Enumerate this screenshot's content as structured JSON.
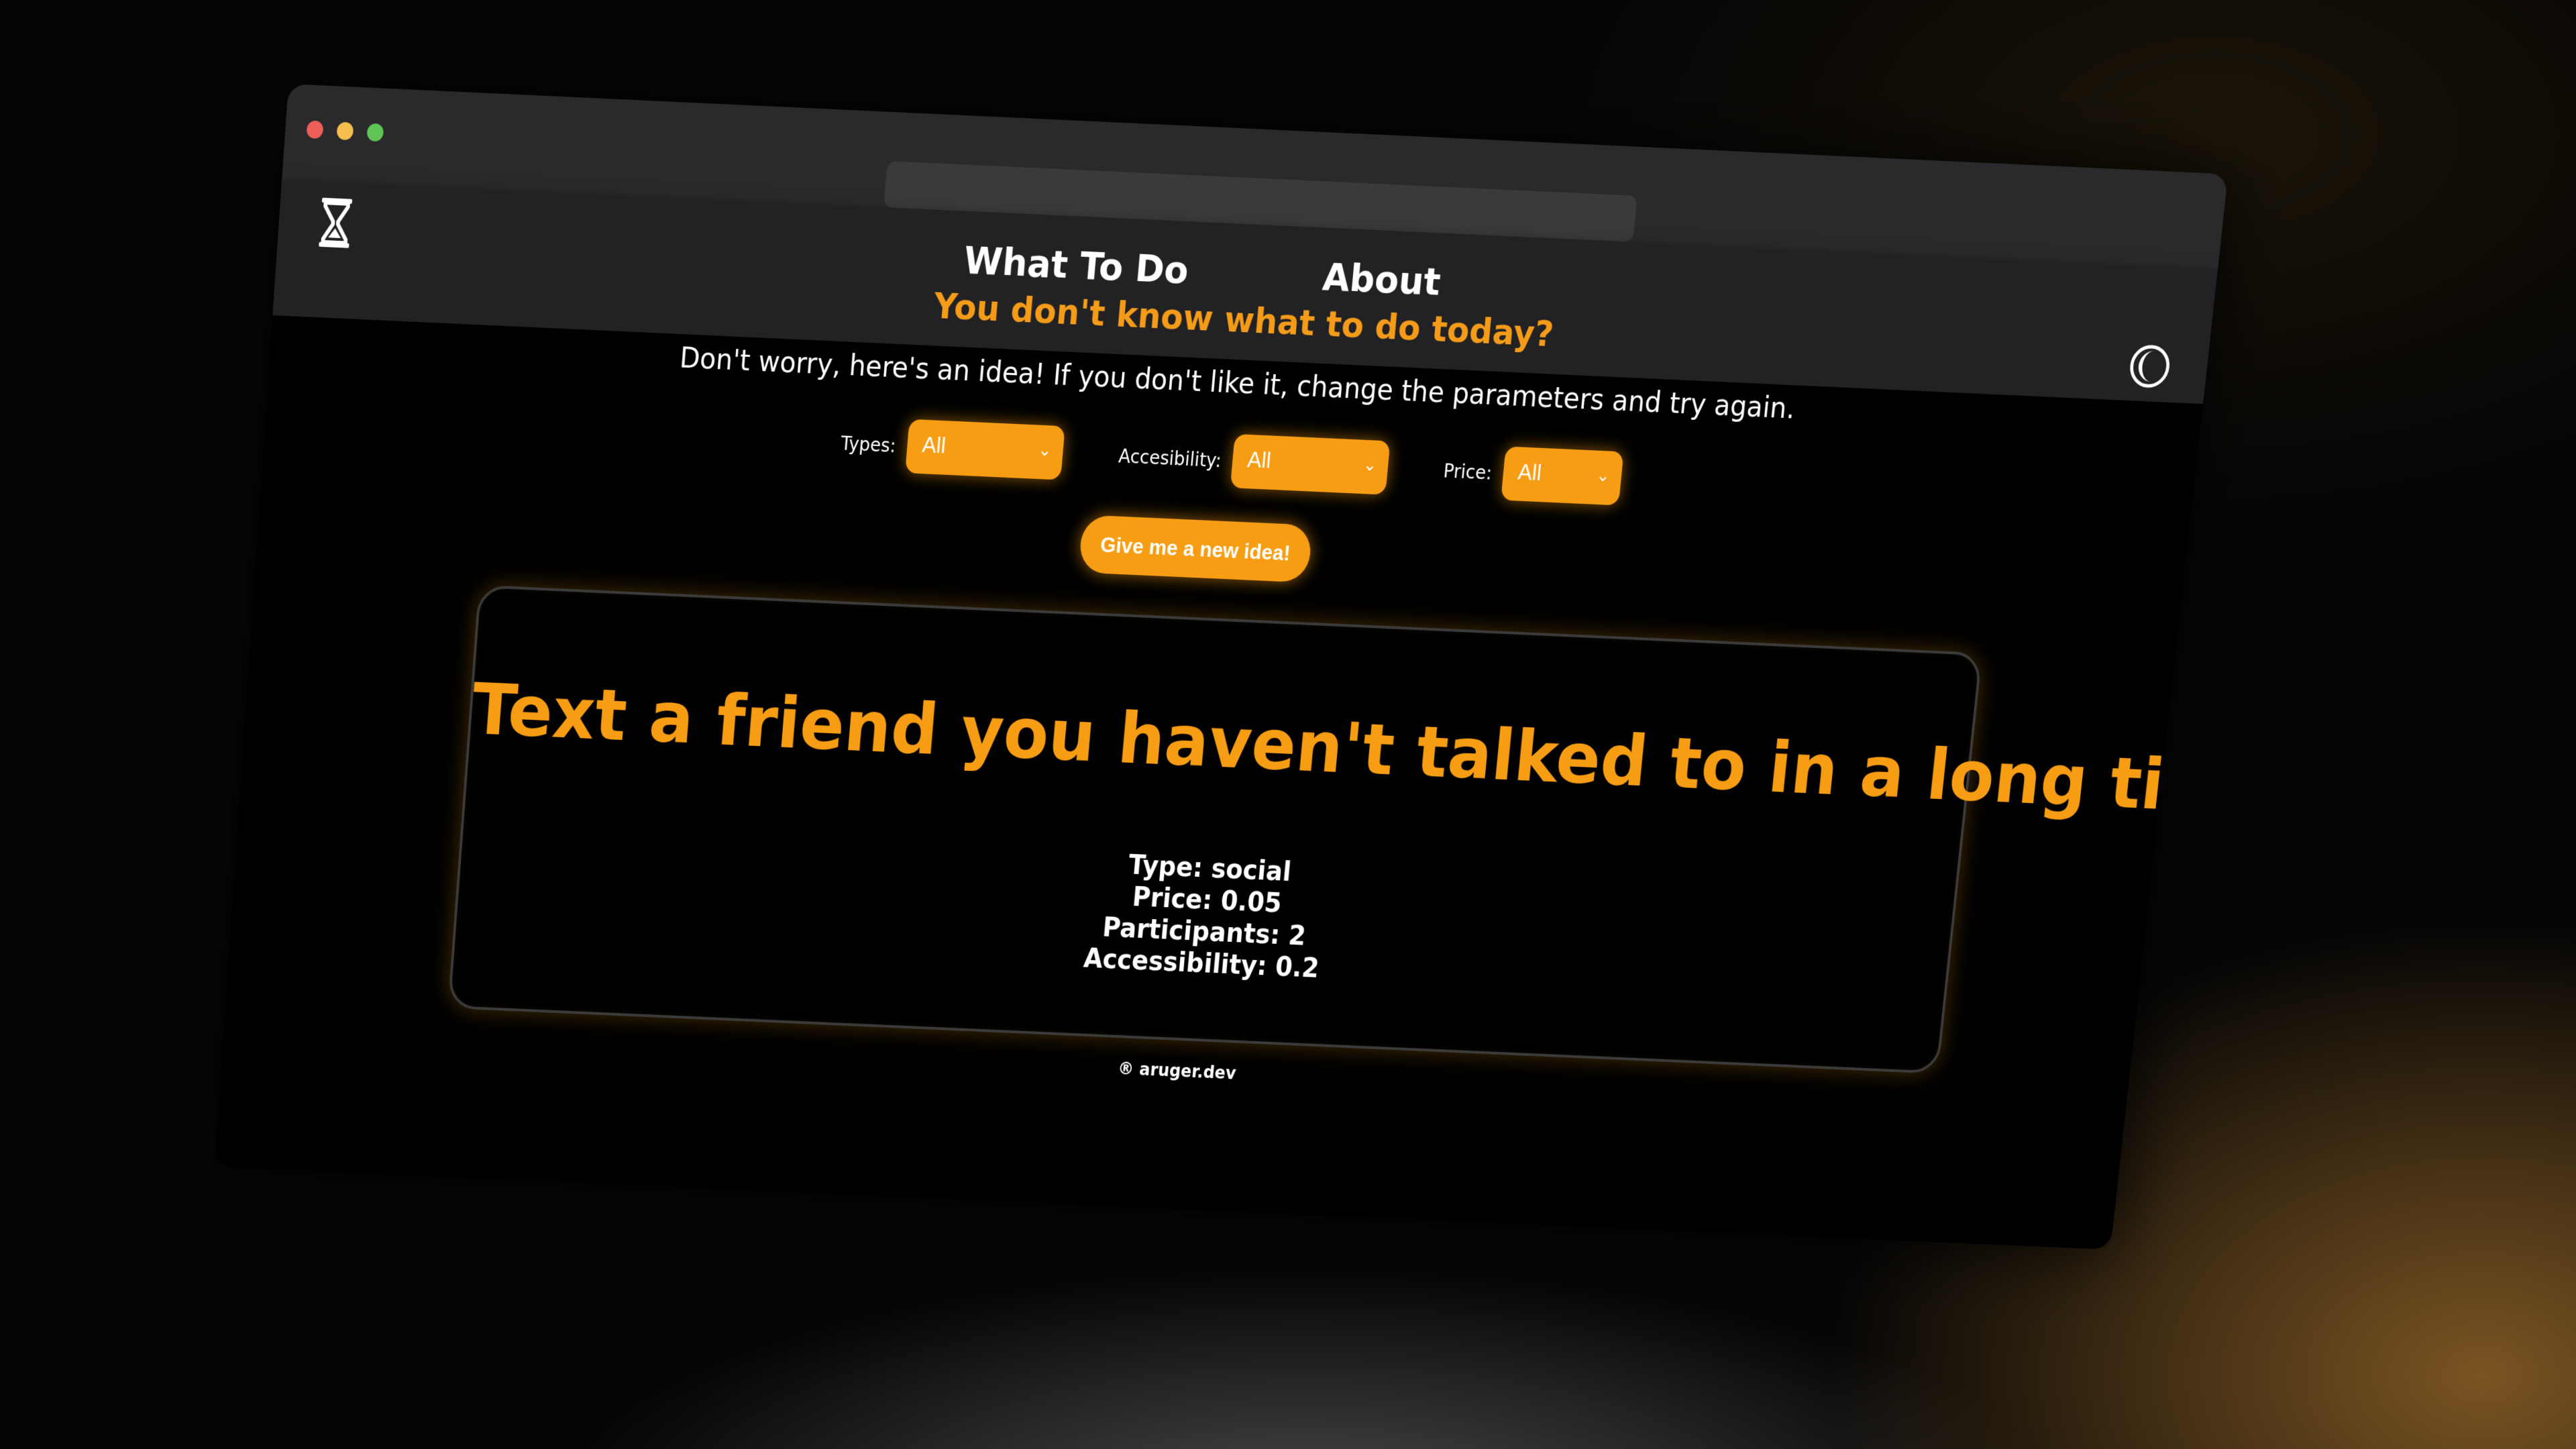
{
  "nav": {
    "what_to_do": "What To Do",
    "about": "About",
    "logo_icon": "hourglass-icon",
    "theme_icon": "moon-icon"
  },
  "hero": {
    "headline": "You don't know what to do today?",
    "subline": "Don't worry, here's an idea! If you don't like it, change the parameters and try again."
  },
  "filters": {
    "types": {
      "label": "Types:",
      "value": "All"
    },
    "accessibility": {
      "label": "Accesibility:",
      "value": "All"
    },
    "price": {
      "label": "Price:",
      "value": "All"
    }
  },
  "cta_label": "Give me a new idea!",
  "activity": {
    "title": "Text a friend you haven't talked to in a long time",
    "type": "Type: social",
    "price": "Price: 0.05",
    "participants": "Participants: 2",
    "accessibility": "Accessibility: 0.2"
  },
  "footer": "® aruger.dev",
  "colors": {
    "accent": "#f69d13",
    "background": "#000000",
    "navbar": "#222224"
  }
}
